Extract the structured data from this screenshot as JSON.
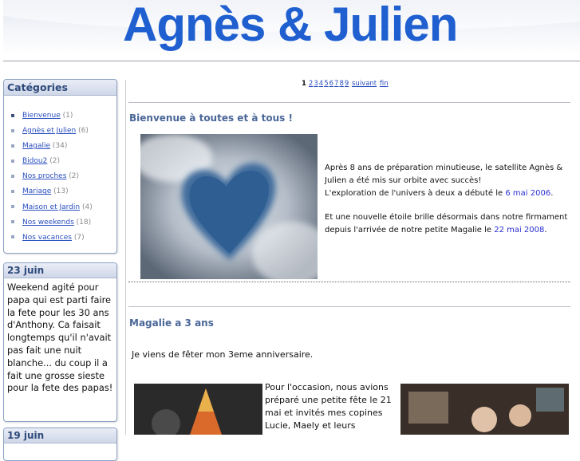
{
  "header": {
    "title": "Agnès & Julien"
  },
  "sidebar": {
    "categories_title": "Catégories",
    "categories": [
      {
        "label": "Bienvenue",
        "count": "(1)",
        "selected": true
      },
      {
        "label": "Agnès et Julien",
        "count": "(6)"
      },
      {
        "label": "Magalie",
        "count": "(34)"
      },
      {
        "label": "Bidou2",
        "count": "(2)"
      },
      {
        "label": "Nos proches",
        "count": "(2)"
      },
      {
        "label": "Mariage",
        "count": "(13)"
      },
      {
        "label": "Maison et Jardin",
        "count": "(4)"
      },
      {
        "label": "Nos weekends",
        "count": "(18)"
      },
      {
        "label": "Nos vacances",
        "count": "(7)"
      }
    ],
    "news": [
      {
        "date": "23 juin",
        "text": "Weekend agité pour papa qui est parti faire la fete pour les 30 ans d'Anthony. Ca faisait longtemps qu'il n'avait pas fait une nuit blanche... du coup il a fait une grosse sieste pour la fete des papas!"
      },
      {
        "date": "19 juin"
      }
    ]
  },
  "pager": {
    "current": "1",
    "pages": [
      "2",
      "3",
      "4",
      "5",
      "6",
      "7",
      "8",
      "9"
    ],
    "next": "suivant",
    "last": "fin"
  },
  "posts": [
    {
      "title": "Bienvenue à toutes et à tous !",
      "p1": "Après 8 ans de préparation minutieuse, le satellite Agnès & Julien a été mis sur orbite avec succès!",
      "p2_before": "L'exploration de l'univers à deux a débuté le ",
      "p2_link": "6 mai 2006",
      "p2_after": ".",
      "p3_before": "Et une nouvelle étoile brille désormais dans notre firmament depuis l'arrivée de notre petite Magalie le ",
      "p3_link": "22 mai 2008",
      "p3_after": "."
    },
    {
      "title": "Magalie a 3 ans",
      "intro": "Je viens de fêter mon 3eme anniversaire.",
      "text": "Pour l'occasion, nous avions préparé une petite fête le 21 mai et invités mes copines Lucie, Maely et leurs"
    }
  ],
  "icons": {
    "category_bullet": "square-bullet-icon"
  },
  "colors": {
    "title_blue": "#1f5fd0",
    "link_blue": "#2a4fbf",
    "heading_slate": "#4a6797"
  }
}
